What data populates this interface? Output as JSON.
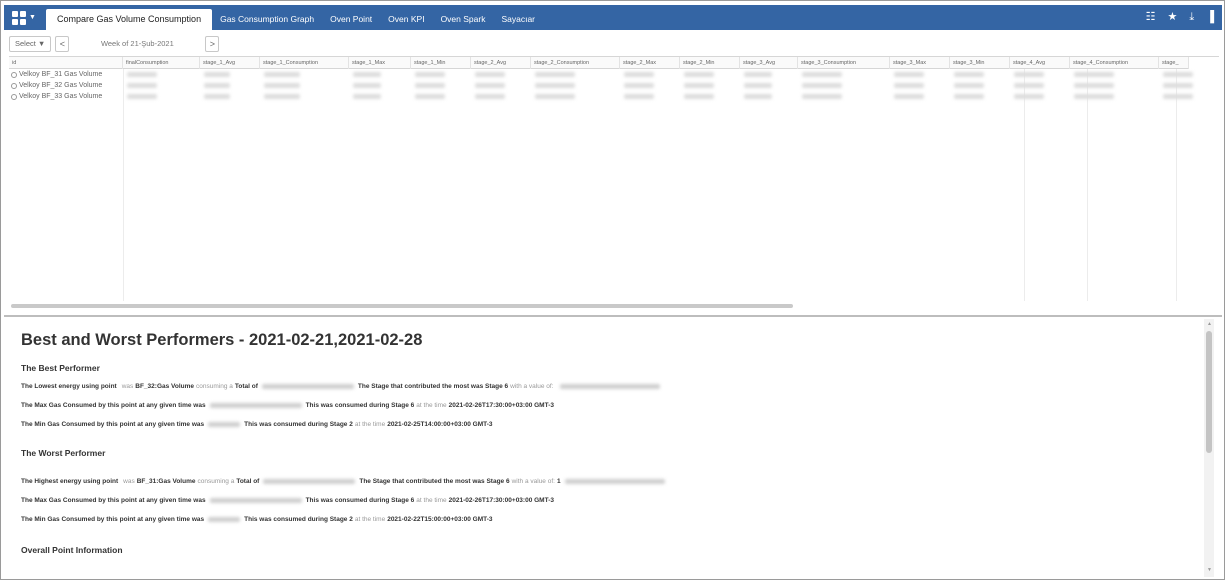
{
  "topbar": {
    "tabs": [
      {
        "label": "Compare Gas Volume Consumption",
        "active": true
      },
      {
        "label": "Gas Consumption Graph",
        "active": false
      },
      {
        "label": "Oven Point",
        "active": false
      },
      {
        "label": "Oven KPI",
        "active": false
      },
      {
        "label": "Oven Spark",
        "active": false
      },
      {
        "label": "Sayacıar",
        "active": false
      }
    ],
    "icons": [
      "apps-grid-icon",
      "list-icon",
      "star-icon",
      "download-icon",
      "sidebar-icon"
    ],
    "icon_glyphs": {
      "list": "☷",
      "star": "★",
      "download": "⤓",
      "sidebar": "▐"
    }
  },
  "toolbar": {
    "select_label": "Select ▼",
    "prev": "<",
    "week_label": "Week of 21-Şub-2021",
    "next": ">"
  },
  "grid": {
    "columns": [
      "id",
      "finalConsumption",
      "stage_1_Avg",
      "stage_1_Consumption",
      "stage_1_Max",
      "stage_1_Min",
      "stage_2_Avg",
      "stage_2_Consumption",
      "stage_2_Max",
      "stage_2_Min",
      "stage_3_Avg",
      "stage_3_Consumption",
      "stage_3_Max",
      "stage_3_Min",
      "stage_4_Avg",
      "stage_4_Consumption",
      "stage_"
    ],
    "rows": [
      {
        "id": "Velkoy BF_31 Gas Volume"
      },
      {
        "id": "Velkoy BF_32 Gas Volume"
      },
      {
        "id": "Velkoy BF_33 Gas Volume"
      }
    ]
  },
  "report": {
    "title": "Best and Worst Performers - 2021-02-21,2021-02-28",
    "best": {
      "heading": "The Best Performer",
      "line1": {
        "a": "The Lowest energy using point",
        "b": "was",
        "c": "BF_32:Gas Volume",
        "d": "consuming a",
        "e": "Total of",
        "f": "The Stage that contributed the most was Stage 6",
        "g": "with a value of:"
      },
      "line2": {
        "a": "The Max Gas Consumed by this point at any given time was",
        "b": "This was consumed during Stage 6",
        "c": "at the time",
        "d": "2021-02-26T17:30:00+03:00 GMT-3"
      },
      "line3": {
        "a": "The Min Gas Consumed by this point at any given time was",
        "b": "This was consumed during Stage 2",
        "c": "at the time",
        "d": "2021-02-25T14:00:00+03:00 GMT-3"
      }
    },
    "worst": {
      "heading": "The Worst Performer",
      "line1": {
        "a": "The Highest energy using point",
        "b": "was",
        "c": "BF_31:Gas Volume",
        "d": "consuming a",
        "e": "Total of",
        "f": "The Stage that contributed the most was Stage 6",
        "g": "with a value of:",
        "h": "1"
      },
      "line2": {
        "a": "The Max Gas Consumed by this point at any given time was",
        "b": "This was consumed during Stage 6",
        "c": "at the time",
        "d": "2021-02-26T17:30:00+03:00 GMT-3"
      },
      "line3": {
        "a": "The Min Gas Consumed by this point at any given time was",
        "b": "This was consumed during Stage 2",
        "c": "at the time",
        "d": "2021-02-22T15:00:00+03:00 GMT-3"
      }
    },
    "overall_heading": "Overall Point Information"
  },
  "colors": {
    "topbar": "#3465a4",
    "active_tab": "#ffffff"
  }
}
